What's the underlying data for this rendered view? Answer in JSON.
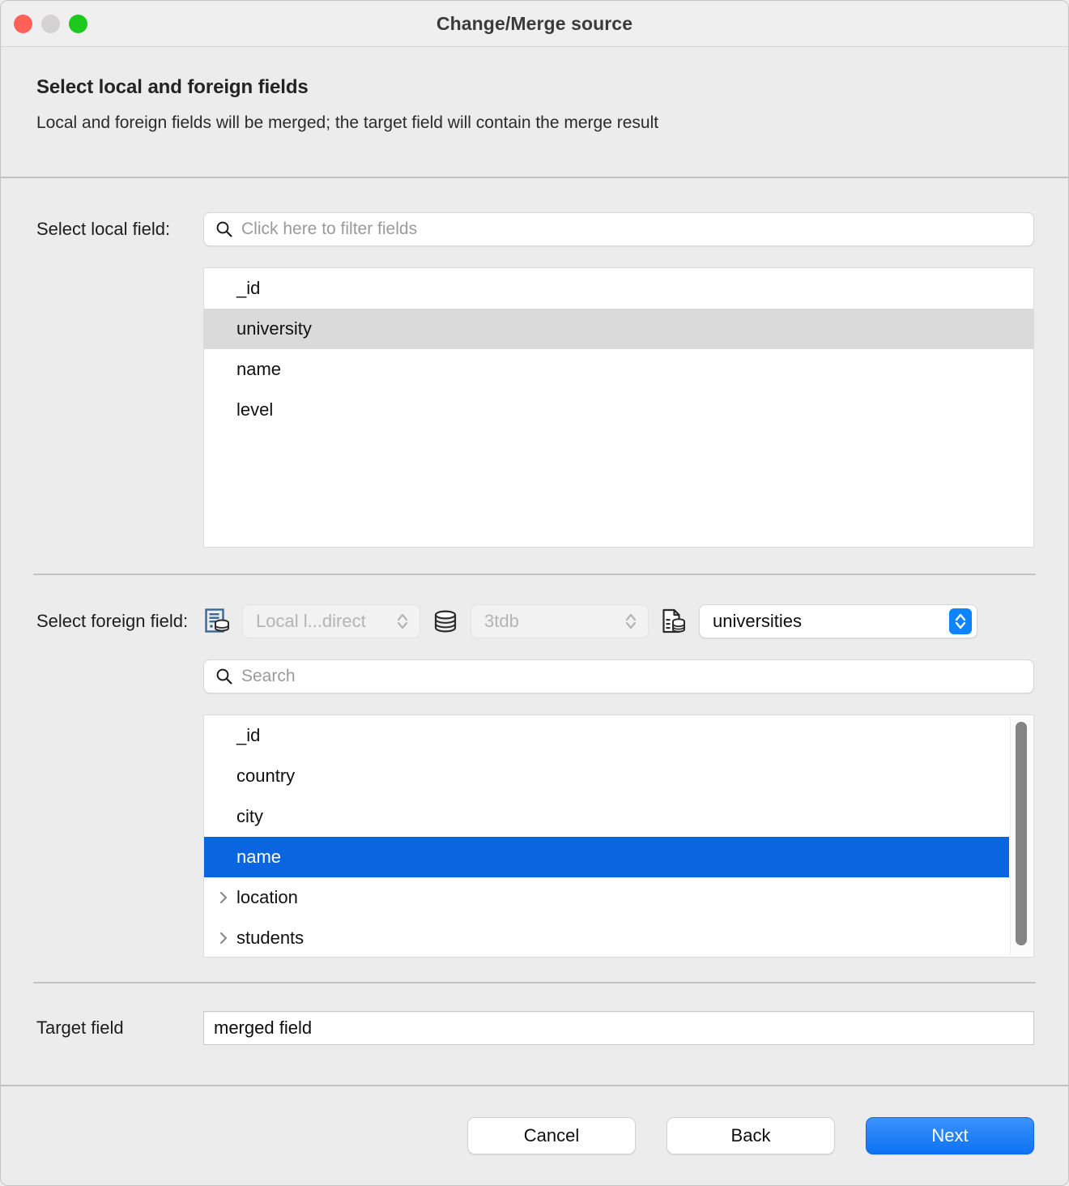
{
  "window": {
    "title": "Change/Merge source",
    "traffic_lights": [
      "close",
      "minimize",
      "zoom"
    ]
  },
  "header": {
    "heading": "Select local and foreign fields",
    "subheading": "Local and foreign fields will be merged; the target field will contain the merge result"
  },
  "local_section": {
    "label": "Select local field:",
    "filter_placeholder": "Click here to filter fields",
    "filter_value": "",
    "search_icon": "search-icon",
    "fields": [
      {
        "name": "_id",
        "selected": false,
        "expandable": false
      },
      {
        "name": "university",
        "selected": true,
        "expandable": false
      },
      {
        "name": "name",
        "selected": false,
        "expandable": false
      },
      {
        "name": "level",
        "selected": false,
        "expandable": false
      }
    ],
    "selected_field": "university"
  },
  "foreign_section": {
    "label": "Select foreign field:",
    "connection": {
      "icon": "connection-icon",
      "value": "Local l...direct",
      "enabled": false
    },
    "database": {
      "icon": "database-icon",
      "value": "3tdb",
      "enabled": false
    },
    "collection": {
      "icon": "collection-icon",
      "value": "universities",
      "enabled": true
    },
    "search_placeholder": "Search",
    "search_value": "",
    "search_icon": "search-icon",
    "fields": [
      {
        "name": "_id",
        "selected": false,
        "expandable": false
      },
      {
        "name": "country",
        "selected": false,
        "expandable": false
      },
      {
        "name": "city",
        "selected": false,
        "expandable": false
      },
      {
        "name": "name",
        "selected": true,
        "expandable": false
      },
      {
        "name": "location",
        "selected": false,
        "expandable": true
      },
      {
        "name": "students",
        "selected": false,
        "expandable": true
      }
    ],
    "selected_field": "name"
  },
  "target": {
    "label": "Target field",
    "value": "merged field"
  },
  "footer": {
    "cancel_label": "Cancel",
    "back_label": "Back",
    "next_label": "Next"
  },
  "colors": {
    "selection_blue": "#0a65e0",
    "primary_button": "#0d72f3",
    "selection_gray": "#dadada",
    "window_background": "#ececec"
  }
}
